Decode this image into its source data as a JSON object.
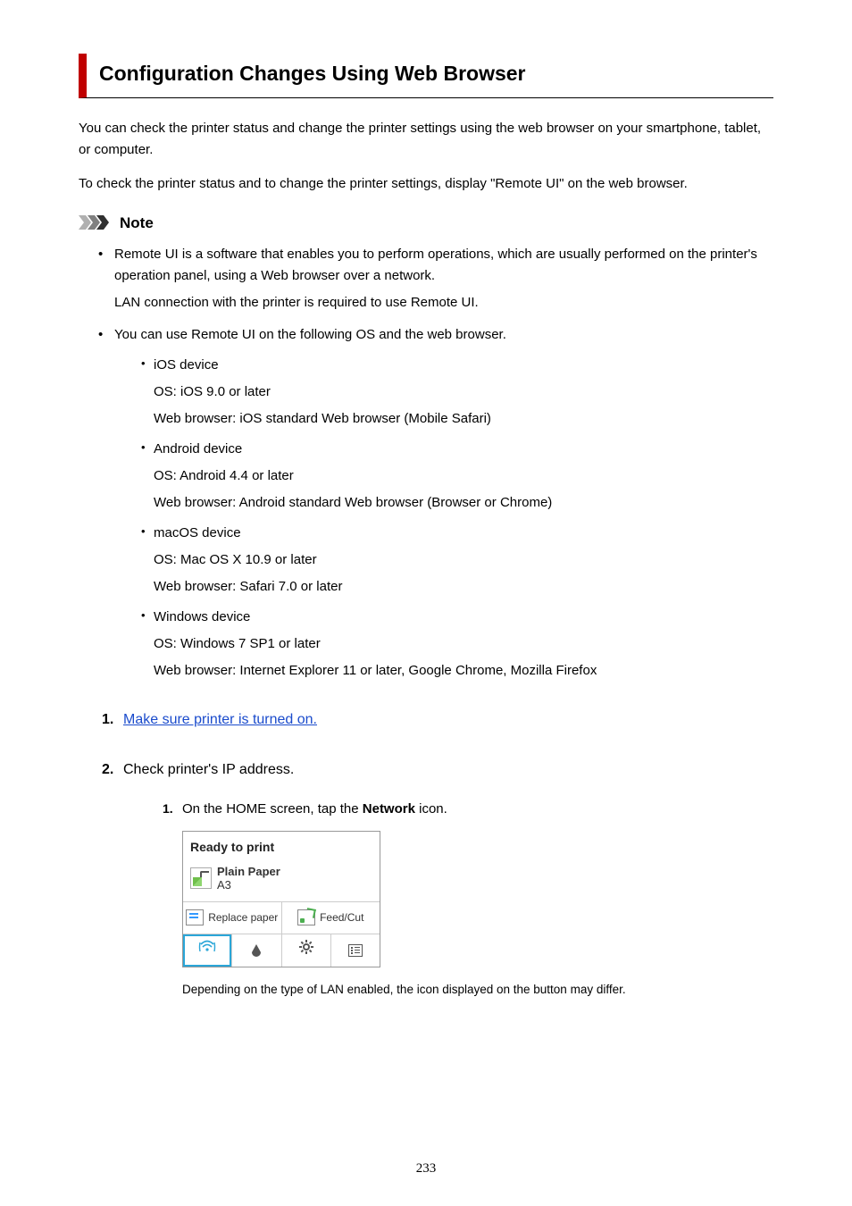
{
  "title": "Configuration Changes Using Web Browser",
  "intro1": "You can check the printer status and change the printer settings using the web browser on your smartphone, tablet, or computer.",
  "intro2": "To check the printer status and to change the printer settings, display \"Remote UI\" on the web browser.",
  "note_label": "Note",
  "notes": {
    "b1": "Remote UI is a software that enables you to perform operations, which are usually performed on the printer's operation panel, using a Web browser over a network.",
    "b1sub": "LAN connection with the printer is required to use Remote UI.",
    "b2": "You can use Remote UI on the following OS and the web browser.",
    "os": [
      {
        "name": "iOS device",
        "os": "OS: iOS 9.0 or later",
        "browser": "Web browser: iOS standard Web browser (Mobile Safari)"
      },
      {
        "name": "Android device",
        "os": "OS: Android 4.4 or later",
        "browser": "Web browser: Android standard Web browser (Browser or Chrome)"
      },
      {
        "name": "macOS device",
        "os": "OS: Mac OS X 10.9 or later",
        "browser": "Web browser: Safari 7.0 or later"
      },
      {
        "name": "Windows device",
        "os": "OS: Windows 7 SP1 or later",
        "browser": "Web browser: Internet Explorer 11 or later, Google Chrome, Mozilla Firefox"
      }
    ]
  },
  "steps": {
    "s1": "Make sure printer is turned on.",
    "s2": "Check printer's IP address.",
    "s2_sub1_pre": "On the HOME screen, tap the ",
    "s2_sub1_bold": "Network",
    "s2_sub1_post": " icon.",
    "s2_caption": "Depending on the type of LAN enabled, the icon displayed on the button may differ."
  },
  "screen": {
    "ready": "Ready to print",
    "paper_name": "Plain Paper",
    "paper_size": "A3",
    "replace": "Replace paper",
    "feedcut": "Feed/Cut",
    "wifi": "((ｙ))"
  },
  "page_number": "233"
}
